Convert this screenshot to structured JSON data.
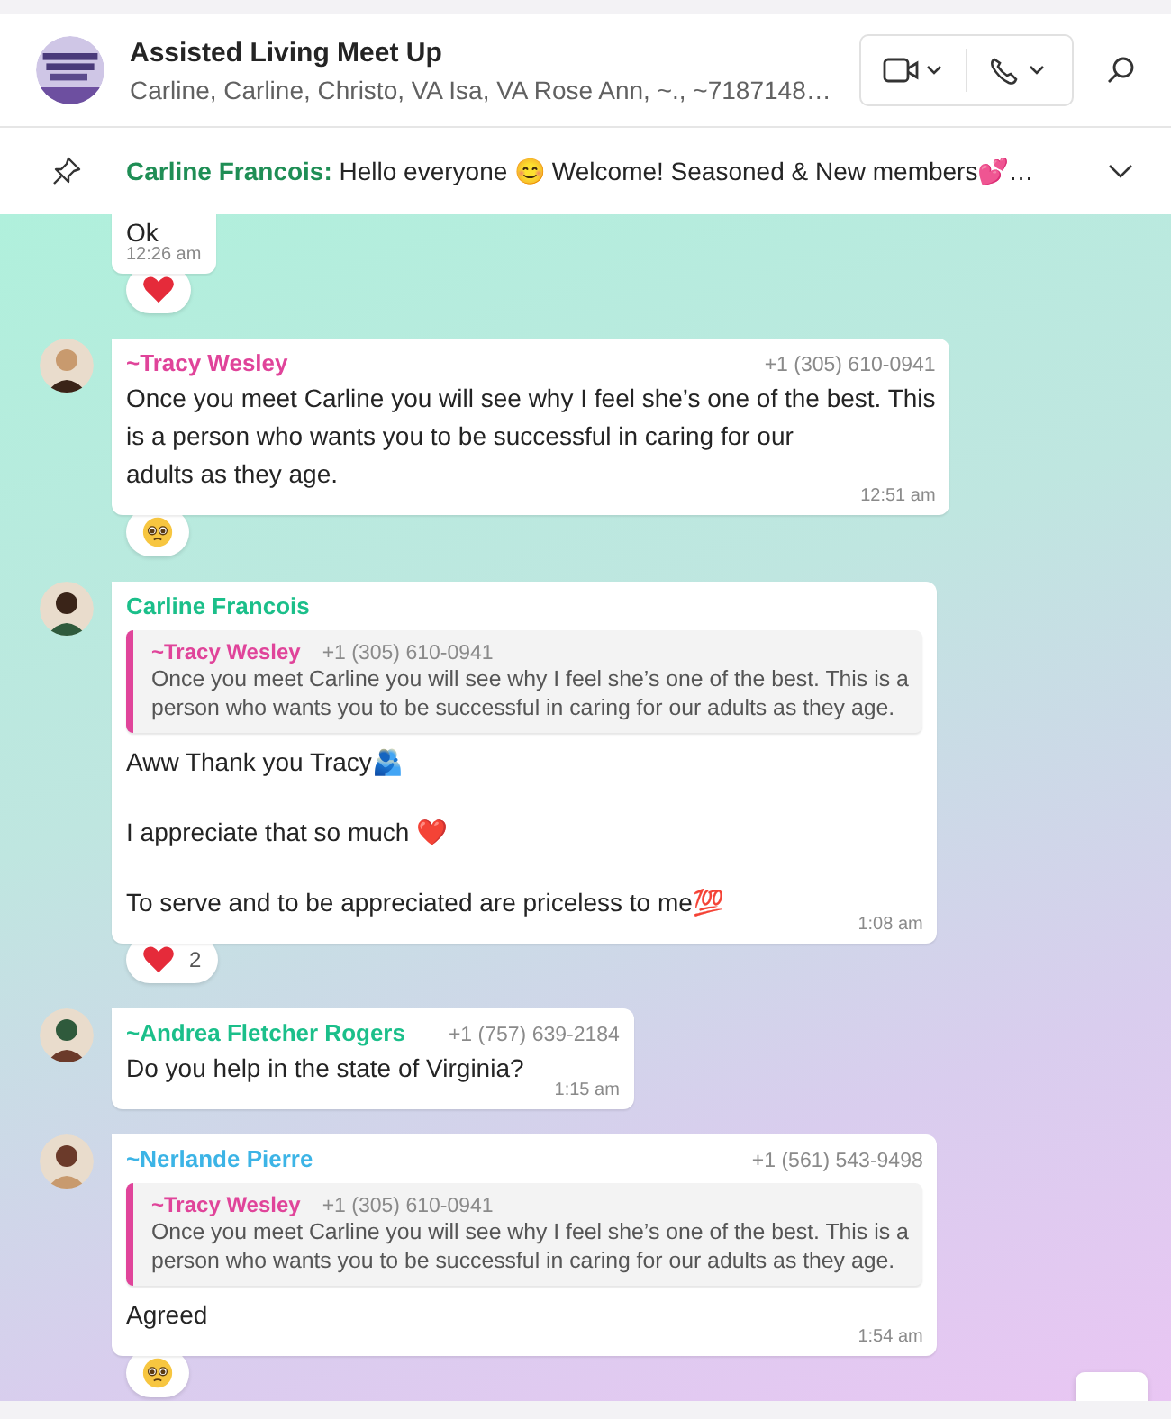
{
  "chat": {
    "title": "Assisted Living Meet Up",
    "participants": "Carline, Carline, Christo, VA Isa, VA Rose Ann, ~., ~7187148…"
  },
  "pinned": {
    "sender": "Carline Francois:",
    "text": "Hello everyone 😊  Welcome! Seasoned & New members💕…"
  },
  "messages": [
    {
      "paragraphs": [
        [
          "Ok"
        ]
      ],
      "time": "12:26 am",
      "reaction": {
        "kind": "heart"
      }
    },
    {
      "sender": "~Tracy Wesley",
      "color": "#e0449a",
      "phone": "+1 (305) 610-0941",
      "paragraphs": [
        [
          "Once you meet Carline you will see why I feel she’s one of the best. This",
          "is a person who wants you to be successful in caring for our",
          "adults as they age."
        ]
      ],
      "time": "12:51 am",
      "reaction": {
        "kind": "teary"
      }
    },
    {
      "sender": "Carline Francois",
      "color": "#1bbf8a",
      "quote": {
        "sender": "~Tracy Wesley",
        "color": "#e0449a",
        "phone": "+1 (305) 610-0941",
        "lines": [
          "Once you meet Carline you will see why I feel she’s one of the best. This is a",
          "person who wants you to be successful in caring for our adults as they age."
        ]
      },
      "paragraphs": [
        [
          "Aww Thank you Tracy🫂"
        ],
        [
          "I appreciate that so much ❤️"
        ],
        [
          "To serve and to be appreciated are priceless to me💯"
        ]
      ],
      "time": "1:08 am",
      "reaction": {
        "kind": "heart",
        "count": "2"
      }
    },
    {
      "sender": "~Andrea Fletcher Rogers",
      "color": "#1bbf8a",
      "phone": "+1 (757) 639-2184",
      "paragraphs": [
        [
          "Do you help in the state of Virginia?"
        ]
      ],
      "time": "1:15 am"
    },
    {
      "sender": "~Nerlande Pierre",
      "color": "#3cb4e6",
      "phone": "+1 (561) 543-9498",
      "quote": {
        "sender": "~Tracy Wesley",
        "color": "#e0449a",
        "phone": "+1 (305) 610-0941",
        "lines": [
          "Once you meet Carline you will see why I feel she’s one of the best. This is a",
          "person who wants you to be successful in caring for our adults as they age."
        ]
      },
      "paragraphs": [
        [
          "Agreed"
        ]
      ],
      "time": "1:54 am",
      "reaction": {
        "kind": "teary"
      }
    }
  ]
}
